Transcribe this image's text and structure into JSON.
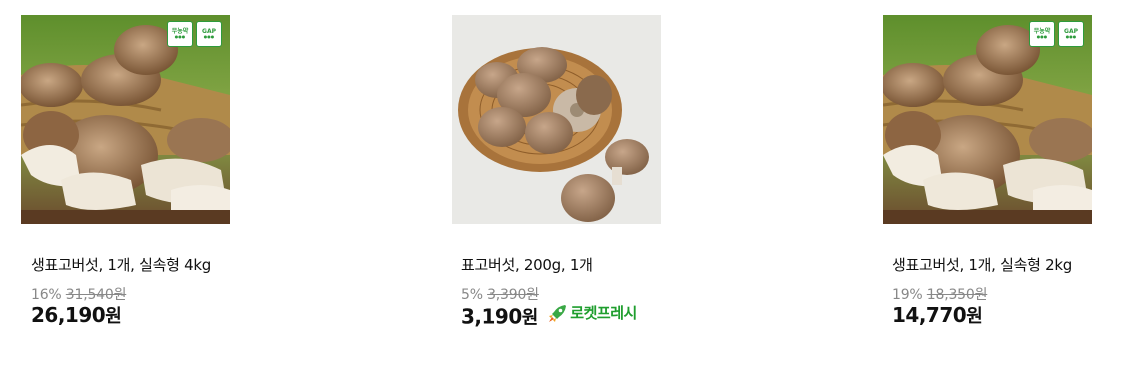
{
  "products": [
    {
      "name": "생표고버섯, 1개, 실속형 4kg",
      "discount": "16%",
      "original_price": "31,540원",
      "price_number": "26,190",
      "price_unit": "원",
      "image_icon": "shiitake-basket-photo",
      "badges": [
        "무농약",
        "GAP"
      ]
    },
    {
      "name": "표고버섯, 200g, 1개",
      "discount": "5%",
      "original_price": "3,390원",
      "price_number": "3,190",
      "price_unit": "원",
      "image_icon": "shiitake-wicker-plate-photo",
      "delivery_badge": "로켓프레시",
      "delivery_color": "#1f9e2e"
    },
    {
      "name": "생표고버섯, 1개, 실속형 2kg",
      "discount": "19%",
      "original_price": "18,350원",
      "price_number": "14,770",
      "price_unit": "원",
      "image_icon": "shiitake-basket-photo",
      "badges": [
        "무농약",
        "GAP"
      ]
    }
  ]
}
